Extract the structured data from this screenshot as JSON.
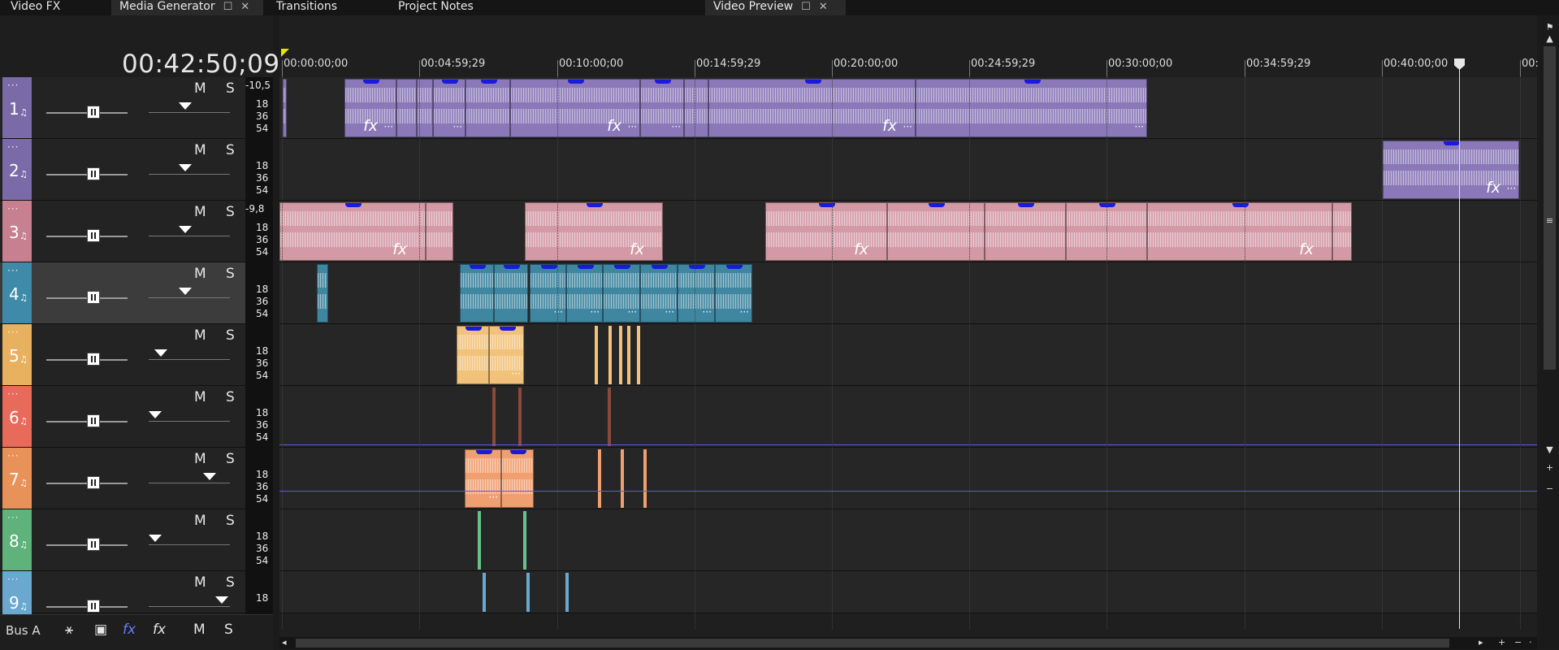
{
  "tabs": [
    {
      "label": "Video FX",
      "active": false
    },
    {
      "label": "Media Generator",
      "active": true
    },
    {
      "label": "Transitions",
      "active": false
    },
    {
      "label": "Project Notes",
      "active": false
    },
    {
      "label": "Video Preview",
      "active": true
    }
  ],
  "timecode": "00:42:50;09",
  "tracks": [
    {
      "num": "1",
      "color": "#7a6aa8",
      "mute": "M",
      "solo": "S",
      "peak": "-10,5",
      "meter": [
        "18",
        "36",
        "54"
      ]
    },
    {
      "num": "2",
      "color": "#7a6aa8",
      "mute": "M",
      "solo": "S",
      "peak": "",
      "meter": [
        "18",
        "36",
        "54"
      ]
    },
    {
      "num": "3",
      "color": "#c7808f",
      "mute": "M",
      "solo": "S",
      "peak": "-9,8",
      "meter": [
        "18",
        "36",
        "54"
      ]
    },
    {
      "num": "4",
      "color": "#3f8aa8",
      "mute": "M",
      "solo": "S",
      "peak": "",
      "meter": [
        "18",
        "36",
        "54"
      ]
    },
    {
      "num": "5",
      "color": "#e8b160",
      "mute": "M",
      "solo": "S",
      "peak": "",
      "meter": [
        "18",
        "36",
        "54"
      ]
    },
    {
      "num": "6",
      "color": "#e86a5a",
      "mute": "M",
      "solo": "S",
      "peak": "",
      "meter": [
        "18",
        "36",
        "54"
      ]
    },
    {
      "num": "7",
      "color": "#e8925a",
      "mute": "M",
      "solo": "S",
      "peak": "",
      "meter": [
        "18",
        "36",
        "54"
      ]
    },
    {
      "num": "8",
      "color": "#5fb27a",
      "mute": "M",
      "solo": "S",
      "peak": "",
      "meter": [
        "18",
        "36",
        "54"
      ]
    },
    {
      "num": "9",
      "color": "#6aa8d0",
      "mute": "M",
      "solo": "S",
      "peak": "",
      "meter": [
        "18"
      ]
    }
  ],
  "bus": {
    "label": "Bus A",
    "mute": "M",
    "solo": "S",
    "fx_label": "fx"
  },
  "ruler_ticks": [
    "00:00:00;00",
    "00:04:59;29",
    "00:10:00;00",
    "00:14:59;29",
    "00:20:00;00",
    "00:24:59;29",
    "00:30:00;00",
    "00:34:59;29",
    "00:40:00;00",
    "00:"
  ],
  "clip_labels": {
    "fx": "fx",
    "more": "···"
  },
  "colors": {
    "purple": "#8a78b8",
    "pink": "#d39aa6",
    "teal": "#3f86a0",
    "yellow": "#f2c27a",
    "orange": "#f0a070",
    "green": "#6ac08a"
  }
}
